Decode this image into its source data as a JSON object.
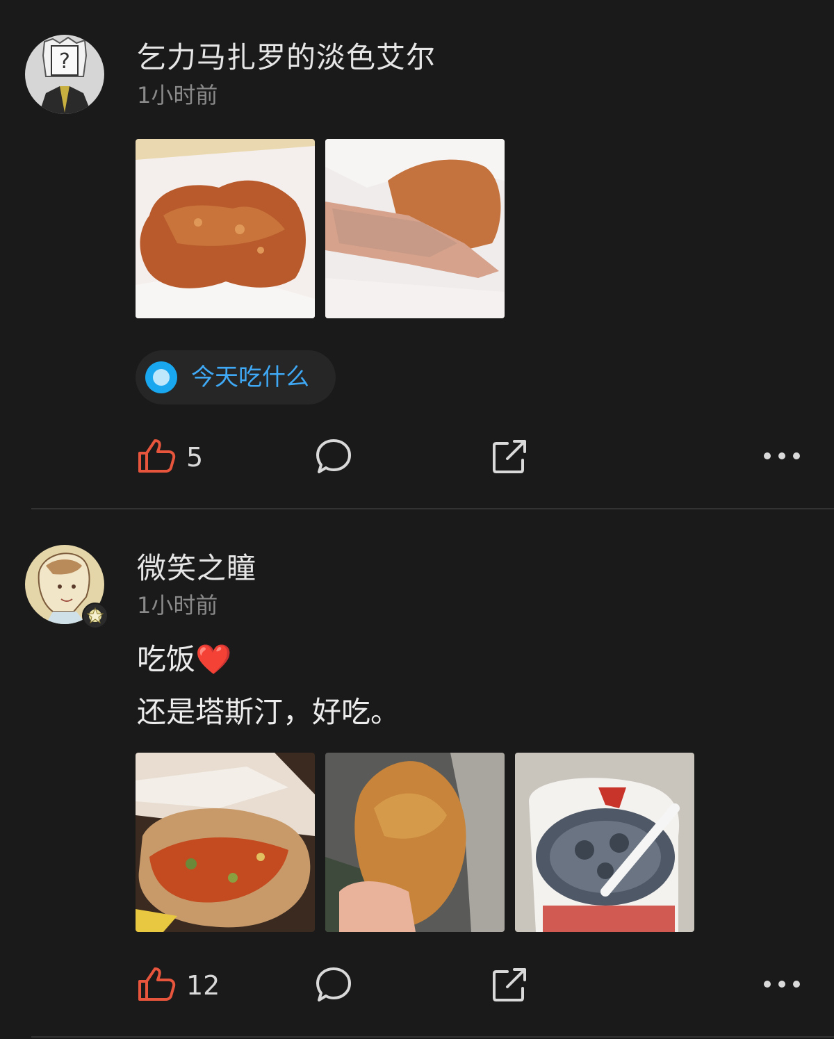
{
  "posts": [
    {
      "username": "乞力马扎罗的淡色艾尔",
      "time": "1小时前",
      "topic": "今天吃什么",
      "likes": "5",
      "images": [
        "fried-chicken-photo-1",
        "fried-chicken-photo-2"
      ]
    },
    {
      "username": "微笑之瞳",
      "time": "1小时前",
      "text_line1": "吃饭",
      "text_line1_emoji": "❤️",
      "text_line2": "还是塔斯汀，好吃。",
      "likes": "12",
      "images": [
        "burger-photo",
        "fried-chicken-hand-photo",
        "drink-cup-photo"
      ]
    }
  ],
  "icons": {
    "like": "thumbs-up-icon",
    "comment": "comment-bubble-icon",
    "share": "share-icon",
    "more": "more-dots-icon"
  },
  "colors": {
    "background": "#1a1a1a",
    "like_accent": "#e8553d",
    "topic_blue": "#3fa9f5"
  }
}
